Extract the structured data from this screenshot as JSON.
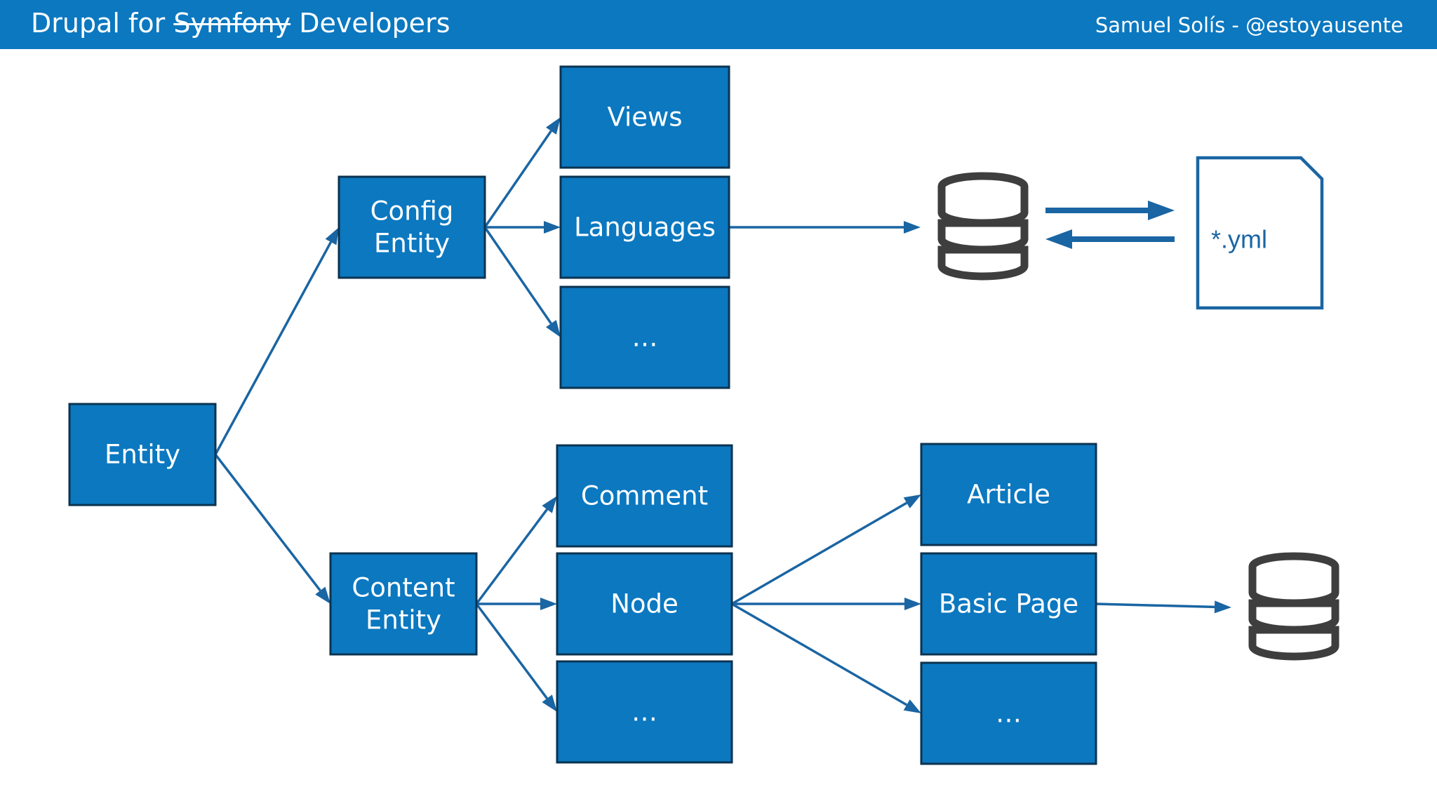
{
  "header": {
    "title_prefix": "Drupal for ",
    "title_struck": "Symfony",
    "title_suffix": " Developers",
    "author": "Samuel Solís - @estoyausente"
  },
  "diagram": {
    "entity": [
      "Entity"
    ],
    "config_entity": [
      "Config",
      "Entity"
    ],
    "content_entity": [
      "Content",
      "Entity"
    ],
    "views": [
      "Views"
    ],
    "languages": [
      "Languages"
    ],
    "config_more": [
      "…"
    ],
    "comment": [
      "Comment"
    ],
    "node": [
      "Node"
    ],
    "content_more": [
      "…"
    ],
    "article": [
      "Article"
    ],
    "basic_page": [
      "Basic Page"
    ],
    "node_more": [
      "…"
    ],
    "yml_file": "*.yml"
  },
  "colors": {
    "header": "#0b78c0",
    "box_fill": "#0b78c0",
    "box_border": "#0b3350",
    "arrow": "#1a65a3",
    "database": "#3e3e3e"
  }
}
